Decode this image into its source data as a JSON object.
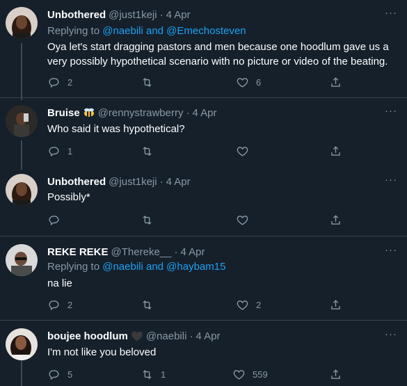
{
  "tweets": [
    {
      "name": "Unbothered",
      "handle": "@just1keji",
      "dot": "·",
      "time": "4 Apr",
      "replying_prefix": "Replying to ",
      "replying_links": "@naebili and @Emechosteven",
      "text": "Oya let's start dragging pastors and men because one hoodlum gave us a very possibly hypothetical scenario with no picture or video of the beating.",
      "replies": "2",
      "retweets": "",
      "likes": "6"
    },
    {
      "name": "Bruise",
      "badge": "bee-emoji",
      "handle": "@rennystrawberry",
      "dot": "·",
      "time": "4 Apr",
      "text": "Who said it was hypothetical?",
      "replies": "1",
      "retweets": "",
      "likes": ""
    },
    {
      "name": "Unbothered",
      "handle": "@just1keji",
      "dot": "·",
      "time": "4 Apr",
      "text": "Possibly*",
      "replies": "",
      "retweets": "",
      "likes": ""
    },
    {
      "name": "REKE REKE",
      "handle": "@Thereke__",
      "dot": "·",
      "time": "4 Apr",
      "replying_prefix": "Replying to ",
      "replying_links": "@naebili and @haybam15",
      "text": "na lie",
      "replies": "2",
      "retweets": "",
      "likes": "2"
    },
    {
      "name": "boujee hoodlum",
      "badge": "black-heart-emoji",
      "handle": "@naebili",
      "dot": "·",
      "time": "4 Apr",
      "text": "I'm not like you beloved",
      "replies": "5",
      "retweets": "1",
      "likes": "559"
    }
  ],
  "more_label": "···",
  "colors": {
    "background": "#15202b",
    "text_primary": "#ffffff",
    "text_secondary": "#8899a6",
    "link": "#1da1f2",
    "divider": "#38444d"
  }
}
